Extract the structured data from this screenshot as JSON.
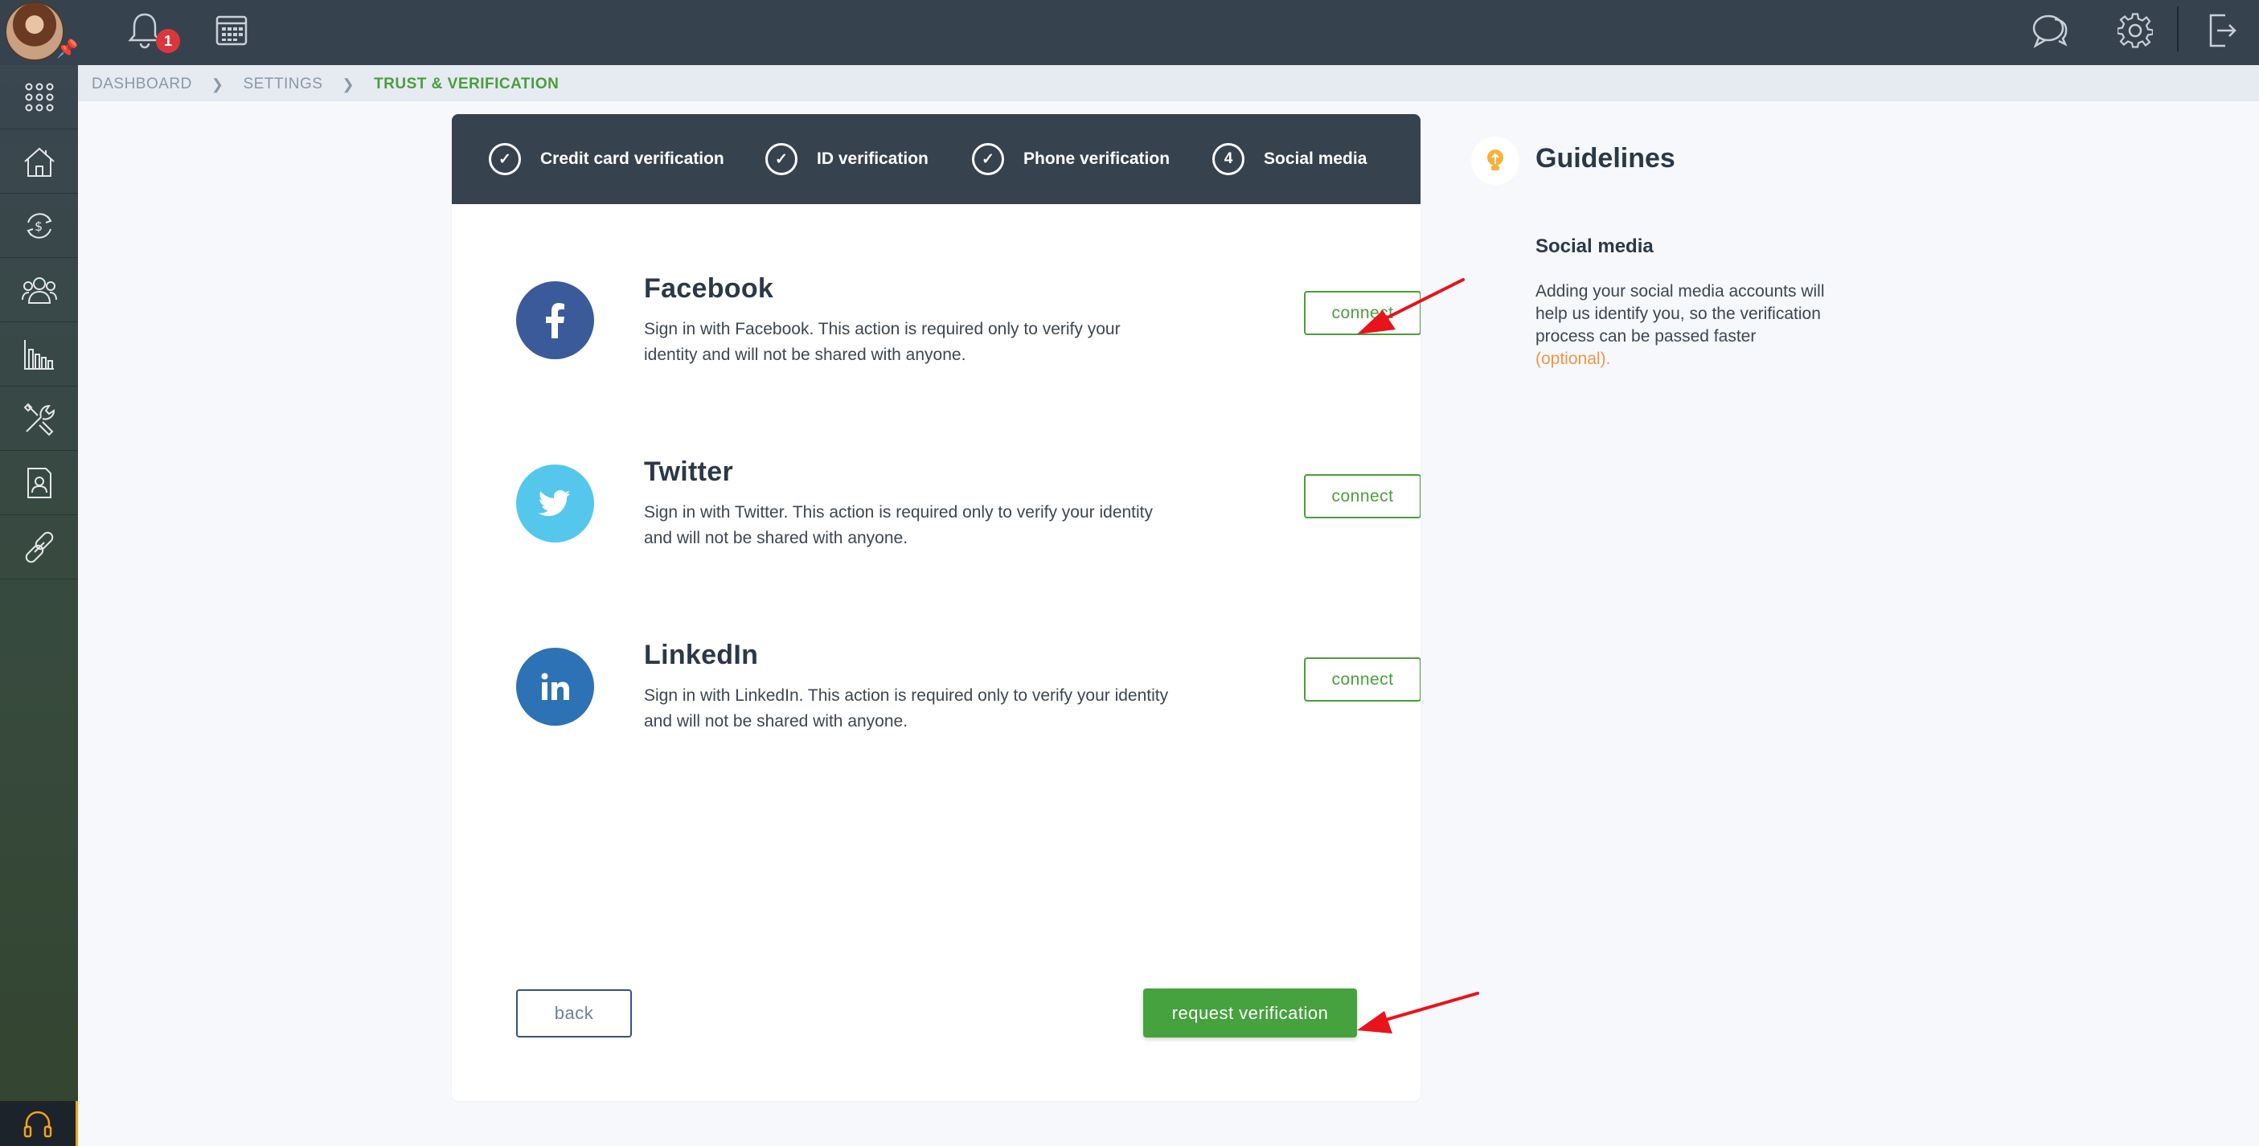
{
  "topbar": {
    "notification_count": "1",
    "icons": [
      "bell-icon",
      "calendar-icon",
      "chat-icon",
      "gear-icon",
      "logout-icon"
    ]
  },
  "sidebar": {
    "items": [
      "apps-grid-icon",
      "property-icon",
      "money-exchange-icon",
      "users-icon",
      "reports-icon",
      "tools-icon",
      "contact-card-icon",
      "link-icon",
      "headset-icon"
    ]
  },
  "breadcrumb": {
    "items": [
      "DASHBOARD",
      "SETTINGS",
      "TRUST & VERIFICATION"
    ]
  },
  "steps": [
    {
      "label": "Credit card verification",
      "marker": "✓"
    },
    {
      "label": "ID verification",
      "marker": "✓"
    },
    {
      "label": "Phone verification",
      "marker": "✓"
    },
    {
      "label": "Social media",
      "marker": "4"
    }
  ],
  "socials": [
    {
      "name": "Facebook",
      "description": "Sign in with Facebook. This action is required only to verify your identity and will not be shared with anyone.",
      "button": "connect",
      "color": "#3b5a9a"
    },
    {
      "name": "Twitter",
      "description": "Sign in with Twitter. This action is required only to verify your identity and will not be shared with anyone.",
      "button": "connect",
      "color": "#55c7ec"
    },
    {
      "name": "LinkedIn",
      "description": "Sign in with LinkedIn. This action is required only to verify your identity and will not be shared with anyone.",
      "button": "connect",
      "color": "#2c72b4"
    }
  ],
  "actions": {
    "back": "back",
    "request": "request verification"
  },
  "guidelines": {
    "title": "Guidelines",
    "subtitle": "Social media",
    "text": "Adding your social media accounts will help us identify you, so the verification process can be passed faster",
    "optional": "(optional)."
  },
  "colors": {
    "topbar": "#37424f",
    "accent_green": "#45a23e",
    "annotation_red": "#e8131b",
    "optional_orange": "#f0954a"
  }
}
